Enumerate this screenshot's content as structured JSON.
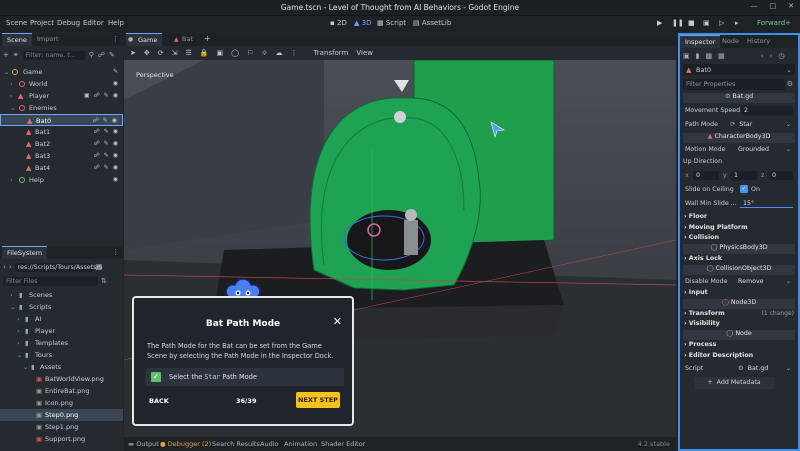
{
  "window": {
    "title": "Game.tscn - Level of Thought from AI Behaviors - Godot Engine"
  },
  "menu": [
    "Scene",
    "Project",
    "Debug",
    "Editor",
    "Help"
  ],
  "workspaces": [
    "2D",
    "3D",
    "Script",
    "AssetLib"
  ],
  "active_workspace": "3D",
  "renderer": "Forward+",
  "scene_dock": {
    "tabs": [
      "Scene",
      "Import"
    ],
    "filter_placeholder": "Filter: name, t...",
    "nodes": [
      {
        "label": "Game",
        "depth": 0
      },
      {
        "label": "World",
        "depth": 1
      },
      {
        "label": "Player",
        "depth": 1
      },
      {
        "label": "Enemies",
        "depth": 1
      },
      {
        "label": "Bat0",
        "depth": 2,
        "selected": true
      },
      {
        "label": "Bat1",
        "depth": 2
      },
      {
        "label": "Bat2",
        "depth": 2
      },
      {
        "label": "Bat3",
        "depth": 2
      },
      {
        "label": "Bat4",
        "depth": 2
      },
      {
        "label": "Help",
        "depth": 1
      }
    ]
  },
  "filesystem": {
    "tab": "FileSystem",
    "path": "res://Scripts/Tours/Assets/S",
    "filter_placeholder": "Filter Files",
    "items": [
      {
        "label": "Scenes",
        "depth": 1
      },
      {
        "label": "Scripts",
        "depth": 1
      },
      {
        "label": "AI",
        "depth": 2
      },
      {
        "label": "Player",
        "depth": 2
      },
      {
        "label": "Templates",
        "depth": 2
      },
      {
        "label": "Tours",
        "depth": 2
      },
      {
        "label": "Assets",
        "depth": 3
      },
      {
        "label": "BatWorldView.png",
        "depth": 4
      },
      {
        "label": "EntireBat.png",
        "depth": 4
      },
      {
        "label": "Icon.png",
        "depth": 4
      },
      {
        "label": "Step0.png",
        "depth": 4,
        "selected": true
      },
      {
        "label": "Step1.png",
        "depth": 4
      },
      {
        "label": "Support.png",
        "depth": 4
      }
    ]
  },
  "viewport": {
    "tabs": [
      "Game",
      "Bat"
    ],
    "toolbar_items": [
      "Transform",
      "View"
    ],
    "perspective_label": "Perspective"
  },
  "inspector": {
    "tabs": [
      "Inspector",
      "Node",
      "History"
    ],
    "node_name": "Bat0",
    "filter_placeholder": "Filter Properties",
    "script_section": "Bat.gd",
    "movement_speed_label": "Movement Speed",
    "movement_speed": "2",
    "path_mode_label": "Path Mode",
    "path_mode": "Star",
    "characterbody": "CharacterBody3D",
    "motion_mode_label": "Motion Mode",
    "motion_mode": "Grounded",
    "up_direction_label": "Up Direction",
    "up_x": "0",
    "up_y": "1",
    "up_z": "0",
    "slide_ceiling_label": "Slide on Ceiling",
    "slide_ceiling_value": "On",
    "wall_min_label": "Wall Min Slide ...",
    "wall_min_value": "15°",
    "categories_a": [
      "Floor",
      "Moving Platform",
      "Collision"
    ],
    "physicsbody": "PhysicsBody3D",
    "axis_lock": "Axis Lock",
    "collisionobject": "CollisionObject3D",
    "disable_mode_label": "Disable Mode",
    "disable_mode": "Remove",
    "input": "Input",
    "node3d": "Node3D",
    "transform": "Transform",
    "transform_note": "(1 change)",
    "visibility": "Visibility",
    "node": "Node",
    "process": "Process",
    "editor_description": "Editor Description",
    "script_label": "Script",
    "script_value": "Bat.gd",
    "add_metadata": "Add Metadata"
  },
  "bottom_panel": [
    "Output",
    "Debugger (2)",
    "Search Results",
    "Audio",
    "Animation",
    "Shader Editor"
  ],
  "version": "4.2.stable",
  "tour": {
    "title": "Bat Path Mode",
    "body_1": "The Path Mode for the Bat can be set from the Game",
    "body_2": "Scene by selecting the Path Mode in the Inspector Dock.",
    "task_prefix": "Select the",
    "task_code": "Star",
    "task_suffix": "Path Mode",
    "back": "BACK",
    "progress": "36/39",
    "next": "NEXT STEP"
  }
}
